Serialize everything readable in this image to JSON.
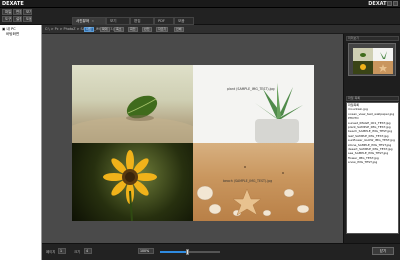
{
  "app": {
    "name": "DEXATE",
    "logo_right": "DEXATE"
  },
  "toolbar": {
    "buttons": [
      "파일 열기",
      "편집",
      "보기",
      "도구",
      "설정",
      "도움말"
    ],
    "tabs": [
      "사진뷰어",
      "보기",
      "편집",
      "PDF",
      "모음"
    ],
    "active_tab_index": 0
  },
  "tree": {
    "root": "내 PC",
    "items": [
      "바탕화면"
    ]
  },
  "pathbar": {
    "path": "C:\\ > Pc > PhotoZ > SAMPLE_IMG_TEST.jpg",
    "buttons": [
      "사진",
      "확대",
      "축소",
      "회전",
      "반전",
      "자르기",
      "인쇄"
    ],
    "blue_button": "사진"
  },
  "photos": {
    "b_label": "plant (SAMPLE_IMG_TEST).jpg",
    "d_label": "beach (SAMPLE_IMG_TEST).jpg"
  },
  "rightpanel": {
    "preview_title": "미리보기",
    "list_title": "파일 목록",
    "files": [
      "파일목록",
      "mountain.jpg",
      "ocean_view_test_wallpaper.jpg",
      "PHOTO",
      "sunset_IMAGE_001_TEST.jpg",
      "plant_SAMPLE_IMG_TEST.jpg",
      "beach_SAMPLE_IMG_TEST.jpg",
      "leaf_SAMPLE_IMG_TEST.jpg",
      "sunflower_GLOW_IMG_TEST.jpg",
      "stone_SAMPLE_IMG_TEST.jpg",
      "desert_SAMPLE_IMG_TEST.jpg",
      "sea_SAMPLE_IMG_TEST.jpg",
      "flower_IMG_TEST.jpg",
      "snow_IMG_TEST.jpg"
    ]
  },
  "status": {
    "page_label": "페이지",
    "page_value": "1",
    "size_label": "크기",
    "size_value": "4",
    "zoom_value": "100%",
    "close_label": "닫기",
    "slider_fraction": 0.45,
    "accent": "#2f8be0"
  }
}
